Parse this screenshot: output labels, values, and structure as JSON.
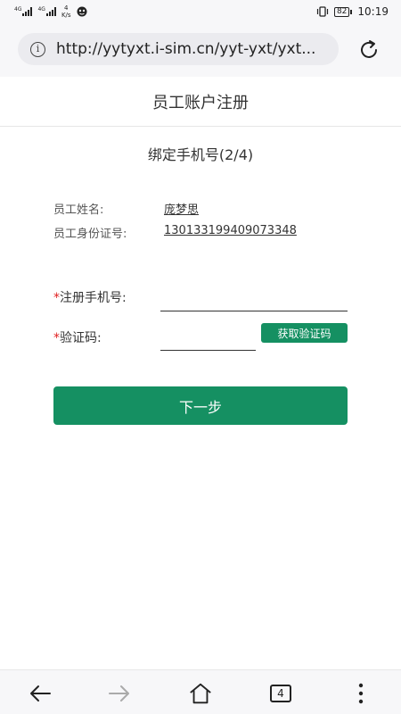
{
  "status_bar": {
    "network_1": "4G",
    "network_2": "4G",
    "speed_value": "4",
    "speed_unit": "K/s",
    "battery": "82",
    "time": "10:19"
  },
  "address_bar": {
    "url": "http://yytyxt.i-sim.cn/yyt-yxt/yxt..."
  },
  "page": {
    "title": "员工账户注册",
    "step_title": "绑定手机号(2/4)"
  },
  "employee": {
    "name_label": "员工姓名:",
    "name_value": "庞梦思",
    "id_label": "员工身份证号:",
    "id_value": "130133199409073348"
  },
  "form": {
    "required_mark": "*",
    "phone_label": "注册手机号:",
    "phone_value": "",
    "code_label": "验证码:",
    "code_value": "",
    "get_code_button": "获取验证码",
    "next_button": "下一步"
  },
  "bottom_nav": {
    "tabs_count": "4"
  }
}
